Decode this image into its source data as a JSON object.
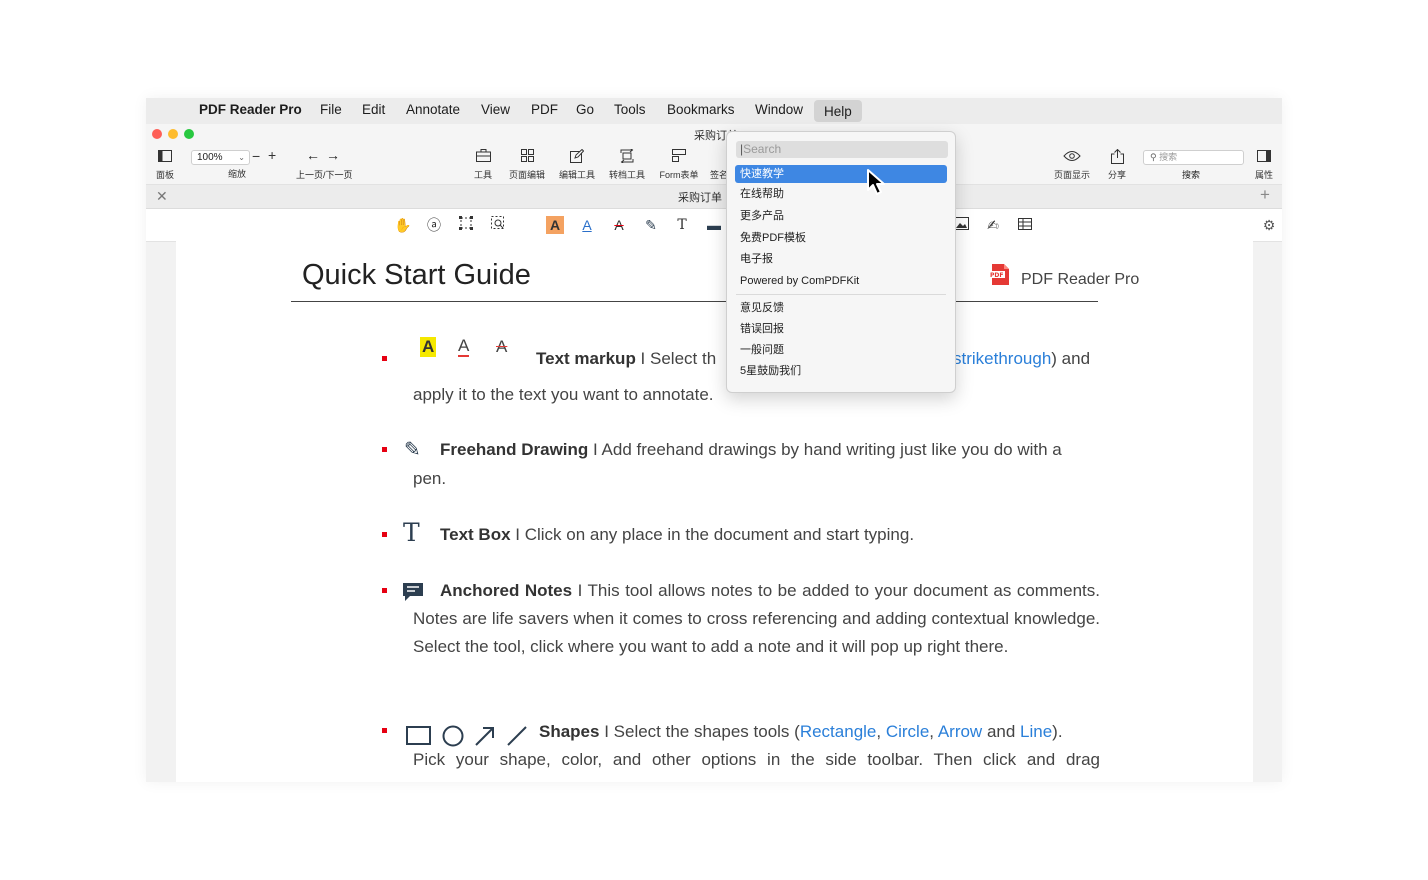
{
  "menubar": {
    "app": "PDF Reader Pro",
    "items": [
      "File",
      "Edit",
      "Annotate",
      "View",
      "PDF",
      "Go",
      "Tools",
      "Bookmarks",
      "Window"
    ],
    "help": "Help"
  },
  "window": {
    "title": "采购订单"
  },
  "toolbar": {
    "panel": "面板",
    "zoom_value": "100%",
    "zoom_label": "缩放",
    "page_nav": "上一页/下一页",
    "tools": "工具",
    "page_edit": "页面编辑",
    "edit_tools": "编辑工具",
    "convert": "转档工具",
    "form": "Form表单",
    "sign": "签名",
    "page_display": "页面显示",
    "share": "分享",
    "search_placeholder": "搜索",
    "search_label": "搜索",
    "properties": "属性"
  },
  "tab": {
    "title": "采购订单"
  },
  "help_menu": {
    "search_placeholder": "Search",
    "items_group1": [
      "快速教学",
      "在线帮助",
      "更多产品",
      "免费PDF模板",
      "电子报",
      "Powered by ComPDFKit"
    ],
    "items_group2": [
      "意见反馈",
      "错误回报",
      "一般问题",
      "5星鼓励我们"
    ],
    "selected": "快速教学"
  },
  "document": {
    "title": "Quick Start Guide",
    "brand": "PDF Reader Pro",
    "brand_badge": "PDF",
    "sections": {
      "markup_title": "Text markup",
      "markup_text_pre": " I Select th",
      "markup_link": "strikethrough",
      "markup_text_post": ") and",
      "markup_line2": "apply it to the text you want to annotate.",
      "freehand_title": "Freehand Drawing",
      "freehand_text": " I Add freehand drawings by hand writing just like you do with a",
      "freehand_line2": "pen.",
      "textbox_title": "Text Box",
      "textbox_text": " I Click on any place in the document and start typing.",
      "notes_title": "Anchored Notes",
      "notes_text": " I This tool allows notes to be added to your document as comments. Notes are life savers when it comes to cross referencing and adding contextual knowledge. Select the tool, click where you want to add a note and it will pop up right there.",
      "shapes_title": "Shapes",
      "shapes_text_pre": " I Select the shapes tools (",
      "shapes_rect": "Rectangle",
      "comma1": ", ",
      "shapes_circle": "Circle",
      "comma2": ", ",
      "shapes_arrow": "Arrow",
      "and": " and ",
      "shapes_line": "Line",
      "shapes_close": ").",
      "shapes_line2": "Pick your shape, color, and other options in the side toolbar. Then click and drag"
    }
  },
  "colors": {
    "accent": "#3e87e3",
    "link": "#2a7fd9",
    "bullet": "#e60012",
    "highlight": "#f5e800"
  }
}
